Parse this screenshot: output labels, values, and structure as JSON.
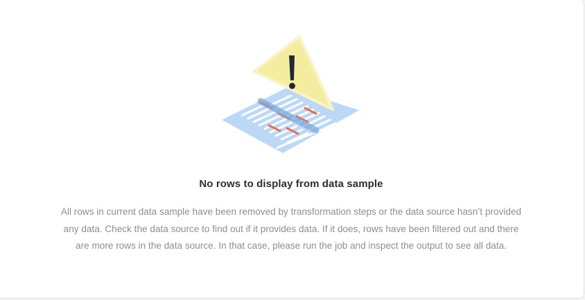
{
  "empty_state": {
    "illustration_icon": "warning-spreadsheet-icon",
    "title": "No rows to display from data sample",
    "description": "All rows in current data sample have been removed by transformation steps or the data source hasn’t provided any data. Check the data source to find out if it provides data. If it does, rows have been filtered out and there are more rows in the data source. In that case, please run the job and inspect the output to see all data."
  },
  "colors": {
    "sheet": "#bcd8f5",
    "row": "#ffffff",
    "highlight_red": "#e0705a",
    "highlight_blue": "#7fa7d9",
    "warning_fill": "#f4eda0",
    "warning_stroke": "#f8f4c9",
    "exclamation": "#1f2a36"
  }
}
